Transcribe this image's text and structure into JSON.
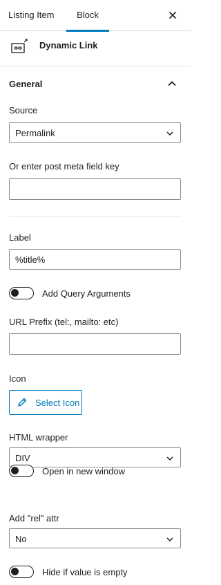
{
  "tabs": {
    "listing": "Listing Item",
    "block": "Block"
  },
  "block": {
    "title": "Dynamic Link",
    "icon": "dynamic-link-icon"
  },
  "panel": {
    "title": "General",
    "expanded": true
  },
  "source": {
    "label": "Source",
    "value": "Permalink"
  },
  "meta_key": {
    "label": "Or enter post meta field key",
    "value": ""
  },
  "link_label": {
    "label": "Label",
    "value": "%title%"
  },
  "query_args": {
    "label": "Add Query Arguments",
    "enabled": false
  },
  "url_prefix": {
    "label": "URL Prefix (tel:, mailto: etc)",
    "value": ""
  },
  "icon": {
    "label": "Icon",
    "button": "Select Icon"
  },
  "html_wrapper": {
    "label": "HTML wrapper",
    "value": "DIV"
  },
  "new_window": {
    "label": "Open in new window",
    "enabled": false
  },
  "rel": {
    "label": "Add \"rel\" attr",
    "value": "No"
  },
  "hide_empty": {
    "label": "Hide if value is empty",
    "enabled": false
  },
  "colors": {
    "accent": "#007cba",
    "text": "#1e1e1e",
    "border": "#8c8c8c"
  }
}
